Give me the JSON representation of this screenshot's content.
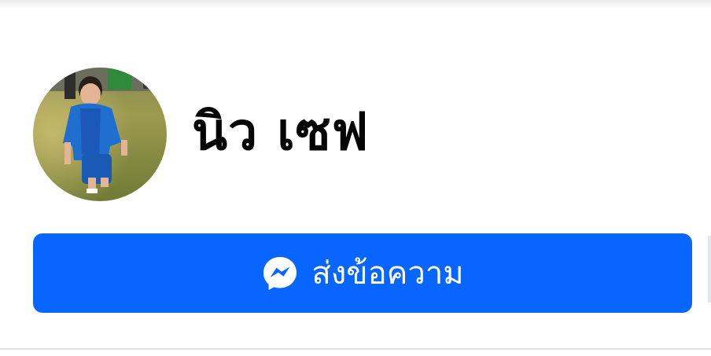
{
  "profile": {
    "name": "นิว เซฟ",
    "avatar_alt": "profile-photo"
  },
  "actions": {
    "message_button_label": "ส่งข้อความ",
    "message_icon": "messenger-icon"
  },
  "colors": {
    "button_bg": "#0866ff",
    "button_text": "#ffffff",
    "name_text": "#050505",
    "divider": "#dadde1"
  }
}
